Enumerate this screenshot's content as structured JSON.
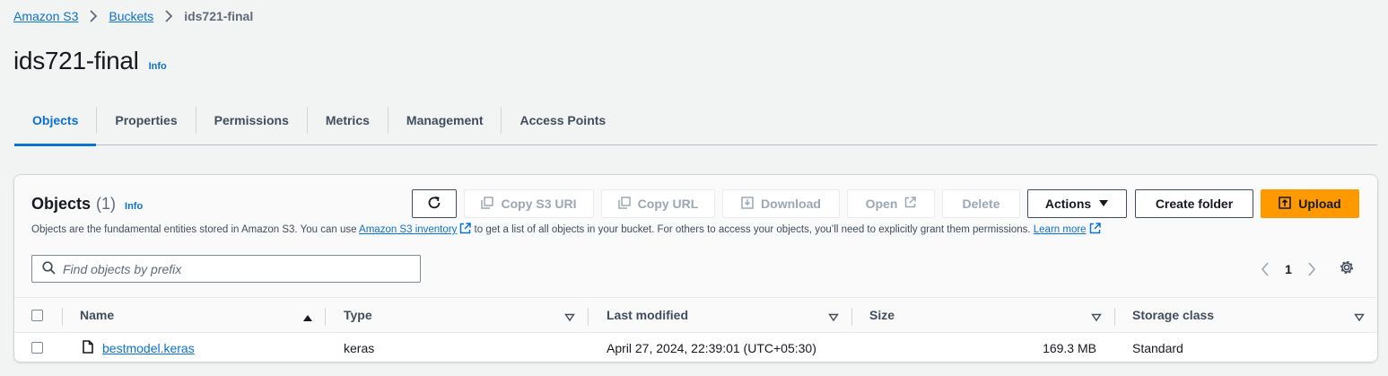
{
  "breadcrumb": {
    "items": [
      "Amazon S3",
      "Buckets"
    ],
    "current": "ids721-final"
  },
  "header": {
    "title": "ids721-final",
    "info_label": "Info"
  },
  "tabs": [
    "Objects",
    "Properties",
    "Permissions",
    "Metrics",
    "Management",
    "Access Points"
  ],
  "active_tab": "Objects",
  "objects_panel": {
    "title": "Objects",
    "count": "(1)",
    "info_label": "Info",
    "description_pre": "Objects are the fundamental entities stored in Amazon S3. You can use ",
    "inventory_link": "Amazon S3 inventory",
    "description_mid": " to get a list of all objects in your bucket. For others to access your objects, you’ll need to explicitly grant them permissions. ",
    "learn_more_link": "Learn more",
    "buttons": {
      "copy_uri": "Copy S3 URI",
      "copy_url": "Copy URL",
      "download": "Download",
      "open": "Open",
      "delete": "Delete",
      "actions": "Actions",
      "create_folder": "Create folder",
      "upload": "Upload"
    },
    "search": {
      "placeholder": "Find objects by prefix",
      "value": ""
    },
    "pagination": {
      "current_page": "1"
    }
  },
  "table": {
    "columns": [
      "Name",
      "Type",
      "Last modified",
      "Size",
      "Storage class"
    ],
    "rows": [
      {
        "name": "bestmodel.keras",
        "type": "keras",
        "last_modified": "April 27, 2024, 22:39:01 (UTC+05:30)",
        "size": "169.3 MB",
        "storage_class": "Standard"
      }
    ]
  },
  "colors": {
    "link": "#0972d3",
    "primary_button": "#ff9900",
    "background": "#f2f3f3"
  }
}
